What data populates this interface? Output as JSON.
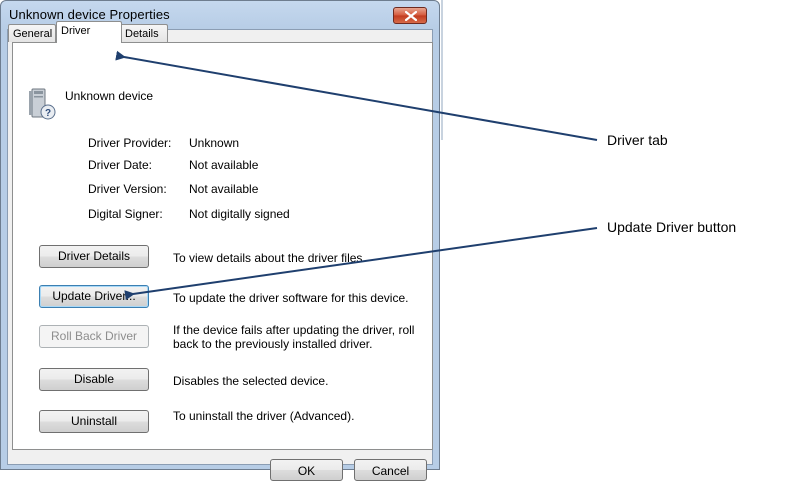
{
  "window": {
    "title": "Unknown device Properties",
    "close_icon": "close-icon"
  },
  "tabs": [
    {
      "label": "General",
      "active": false
    },
    {
      "label": "Driver",
      "active": true
    },
    {
      "label": "Details",
      "active": false
    }
  ],
  "device": {
    "icon": "unknown-device-icon",
    "name": "Unknown device"
  },
  "driver_info": [
    {
      "label": "Driver Provider:",
      "value": "Unknown"
    },
    {
      "label": "Driver Date:",
      "value": "Not available"
    },
    {
      "label": "Driver Version:",
      "value": "Not available"
    },
    {
      "label": "Digital Signer:",
      "value": "Not digitally signed"
    }
  ],
  "actions": [
    {
      "button": "Driver Details",
      "description": "To view details about the driver files.",
      "enabled": true
    },
    {
      "button": "Update Driver...",
      "description": "To update the driver software for this device.",
      "enabled": true
    },
    {
      "button": "Roll Back Driver",
      "description_lines": [
        "If the device fails after updating the driver, roll",
        "back to the previously installed driver."
      ],
      "enabled": false
    },
    {
      "button": "Disable",
      "description": "Disables the selected device.",
      "enabled": true
    },
    {
      "button": "Uninstall",
      "description": "To uninstall the driver (Advanced).",
      "enabled": true
    }
  ],
  "footer": {
    "ok_label": "OK",
    "cancel_label": "Cancel"
  },
  "callouts": {
    "driver_tab": "Driver tab",
    "update_driver_button": "Update Driver button",
    "arrow_color": "#1f3f6e"
  }
}
